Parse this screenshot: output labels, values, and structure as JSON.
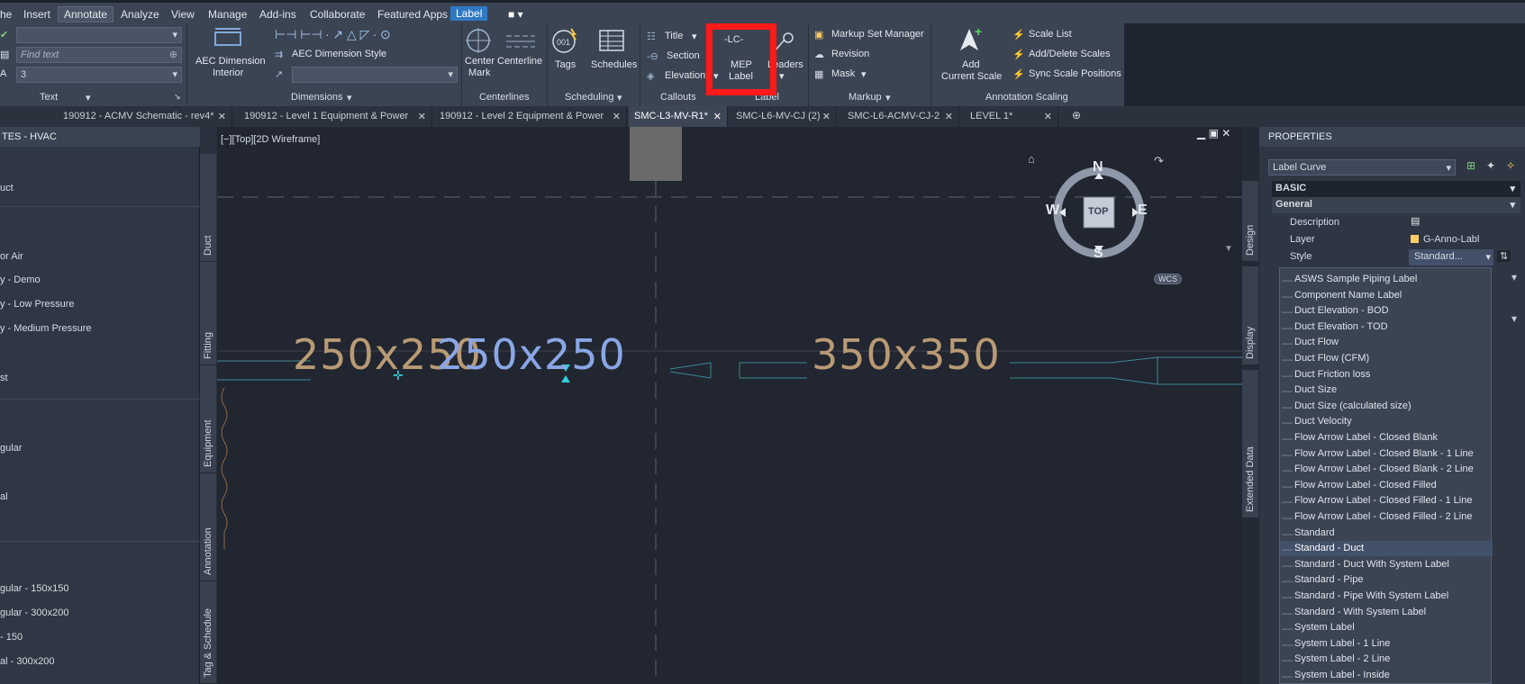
{
  "menubar": {
    "items": [
      "he",
      "Insert",
      "Annotate",
      "Analyze",
      "View",
      "Manage",
      "Add-ins",
      "Collaborate",
      "Featured Apps",
      "Label"
    ],
    "active": "Annotate"
  },
  "ribbon": {
    "text_panel": {
      "find_placeholder": "Find text",
      "height_value": "3",
      "title": "Text"
    },
    "dimensions_panel": {
      "aec_dimension": "AEC Dimension",
      "interior": "Interior",
      "dim_style": "AEC Dimension Style",
      "title": "Dimensions"
    },
    "centerlines_panel": {
      "center_mark_1": "Center",
      "center_mark_2": "Mark",
      "centerline": "Centerline",
      "title": "Centerlines"
    },
    "scheduling_panel": {
      "tags": "Tags",
      "schedules": "Schedules",
      "title": "Scheduling"
    },
    "callouts_panel": {
      "title_btn": "Title",
      "section": "Section",
      "elevation": "Elevation",
      "title": "Callouts"
    },
    "label_panel": {
      "mep_1": "MEP",
      "mep_2": "Label",
      "leaders": "Leaders",
      "icon_text": "-LC-",
      "title": "Label"
    },
    "markup_panel": {
      "manager": "Markup Set Manager",
      "revision": "Revision",
      "mask": "Mask",
      "title": "Markup"
    },
    "scaling_panel": {
      "add_1": "Add",
      "add_2": "Current Scale",
      "scale_list": "Scale List",
      "add_delete": "Add/Delete Scales",
      "sync": "Sync Scale Positions",
      "title": "Annotation Scaling"
    }
  },
  "doctabs": [
    {
      "label": "190912 - ACMV Schematic - rev4*"
    },
    {
      "label": "190912 - Level 1 Equipment & Power"
    },
    {
      "label": "190912 - Level 2 Equipment & Power"
    },
    {
      "label": "SMC-L3-MV-R1*"
    },
    {
      "label": "SMC-L6-MV-CJ (2)"
    },
    {
      "label": "SMC-L6-ACMV-CJ-2"
    },
    {
      "label": "LEVEL 1*"
    }
  ],
  "left_palette": {
    "title": "TES - HVAC",
    "items": [
      "uct",
      "or Air",
      "y - Demo",
      "y - Low Pressure",
      "y - Medium Pressure",
      "st",
      "gular",
      "al",
      "gular - 150x150",
      "gular - 300x200",
      "- 150",
      "al - 300x200"
    ],
    "tabs": [
      "Duct",
      "Fitting",
      "Equipment",
      "Annotation",
      "Tag & Schedule"
    ]
  },
  "viewport": {
    "label": "[−][Top][2D Wireframe]",
    "duct_labels": [
      "250x250",
      "250x250",
      "350x350"
    ],
    "compass": {
      "n": "N",
      "s": "S",
      "e": "E",
      "w": "W",
      "top": "TOP",
      "wcs": "WCS"
    }
  },
  "properties": {
    "title": "PROPERTIES",
    "object_type": "Label Curve",
    "section_basic": "BASIC",
    "section_general": "General",
    "rows": [
      {
        "name": "Description",
        "value": ""
      },
      {
        "name": "Layer",
        "value": "G-Anno-Labl"
      },
      {
        "name": "Style",
        "value": "Standard..."
      }
    ],
    "side_tabs": [
      "Design",
      "Display",
      "Extended Data"
    ],
    "style_options": [
      "ASWS Sample Piping Label",
      "Component Name Label",
      "Duct Elevation - BOD",
      "Duct Elevation - TOD",
      "Duct Flow",
      "Duct Flow (CFM)",
      "Duct Friction loss",
      "Duct Size",
      "Duct Size (calculated size)",
      "Duct Velocity",
      "Flow Arrow Label - Closed Blank",
      "Flow Arrow Label - Closed Blank - 1 Line",
      "Flow Arrow Label - Closed Blank - 2 Line",
      "Flow Arrow Label - Closed Filled",
      "Flow Arrow Label - Closed Filled - 1 Line",
      "Flow Arrow Label - Closed Filled - 2 Line",
      "Standard",
      "Standard - Duct",
      "Standard - Duct With System Label",
      "Standard - Pipe",
      "Standard - Pipe With System Label",
      "Standard - With System Label",
      "System Label",
      "System Label - 1 Line",
      "System Label - 2 Line",
      "System Label - Inside"
    ],
    "selected_option": "Standard - Duct"
  },
  "colors": {
    "highlight": "#ff1a1a",
    "duct_label": "#b89a74",
    "selected_label": "#8aa6e6",
    "duct_line": "#3d8a95"
  }
}
